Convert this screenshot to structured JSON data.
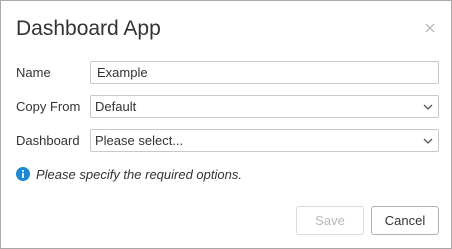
{
  "dialog": {
    "title": "Dashboard App",
    "close_icon": "close-icon"
  },
  "form": {
    "name_label": "Name",
    "name_value": "Example",
    "copy_from_label": "Copy From",
    "copy_from_value": "Default",
    "dashboard_label": "Dashboard",
    "dashboard_value": "Please select..."
  },
  "info": {
    "icon": "info-icon",
    "text": "Please specify the required options."
  },
  "buttons": {
    "save_label": "Save",
    "save_disabled": true,
    "cancel_label": "Cancel"
  },
  "colors": {
    "info_icon": "#1e88d2",
    "border": "#c8c8c8"
  }
}
